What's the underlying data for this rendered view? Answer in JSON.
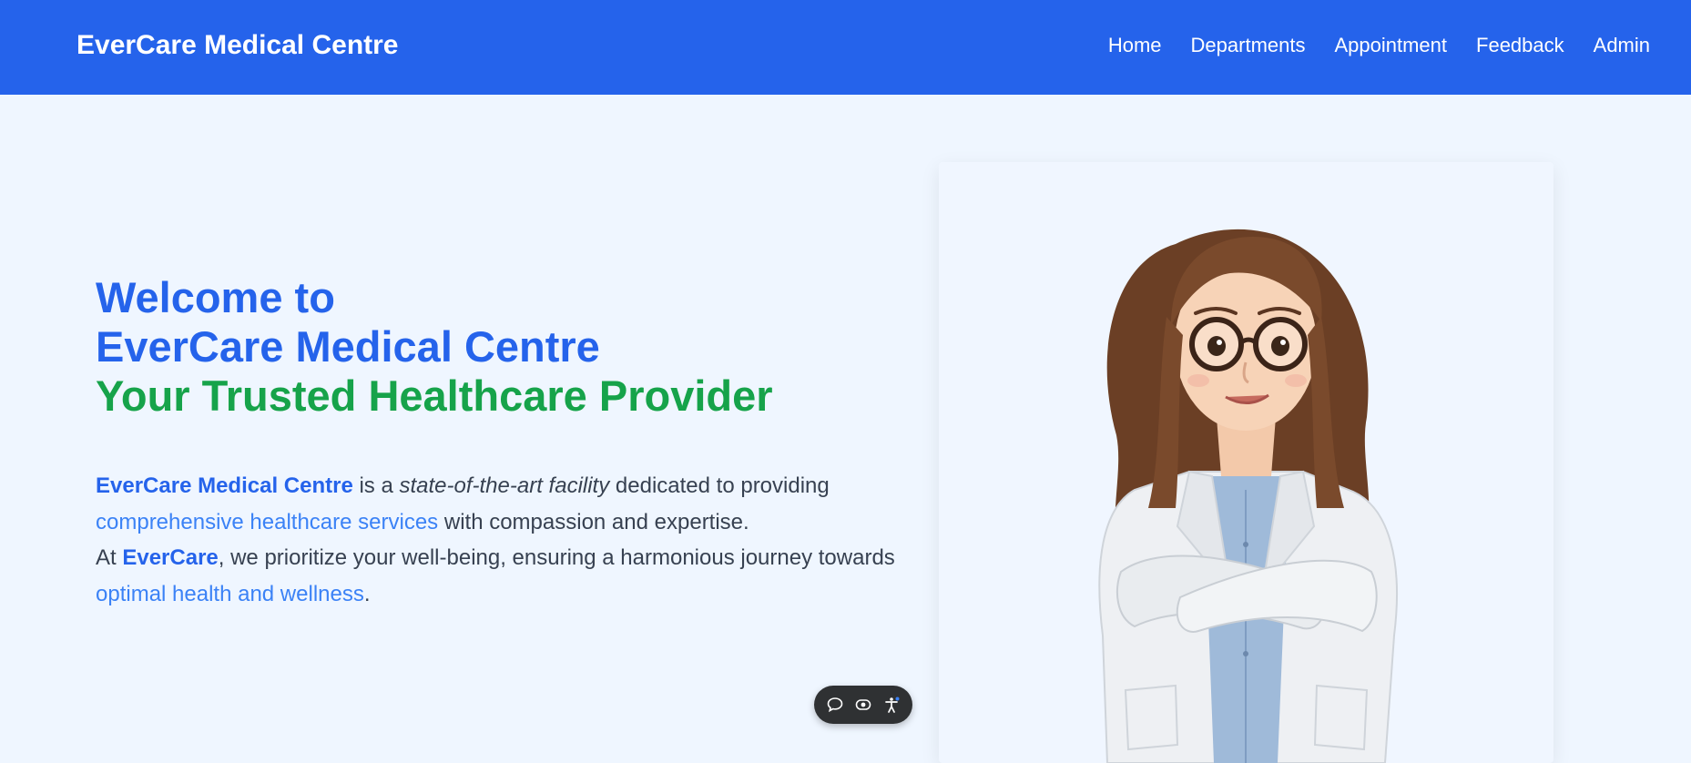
{
  "header": {
    "brand": "EverCare Medical Centre",
    "nav": [
      "Home",
      "Departments",
      "Appointment",
      "Feedback",
      "Admin"
    ]
  },
  "hero": {
    "title_line1": "Welcome to",
    "title_line2": "EverCare Medical Centre",
    "title_line3": "Your Trusted Healthcare Provider",
    "desc": {
      "brand": "EverCare Medical Centre",
      "t1": " is a ",
      "em": "state-of-the-art facility",
      "t2": " dedicated to providing ",
      "link1": "comprehensive healthcare services",
      "t3": " with compassion and expertise.",
      "t4": "At ",
      "brand_short": "EverCare",
      "t5": ", we prioritize your well-being, ensuring a harmonious journey towards ",
      "link2": "optimal health and wellness",
      "t6": "."
    }
  },
  "toolbar": {
    "icons": [
      "speech-bubble-icon",
      "eye-icon",
      "accessibility-person-icon"
    ]
  },
  "colors": {
    "primary": "#2563eb",
    "accent_green": "#16a34a",
    "background": "#eff6ff",
    "link": "#3b82f6"
  }
}
